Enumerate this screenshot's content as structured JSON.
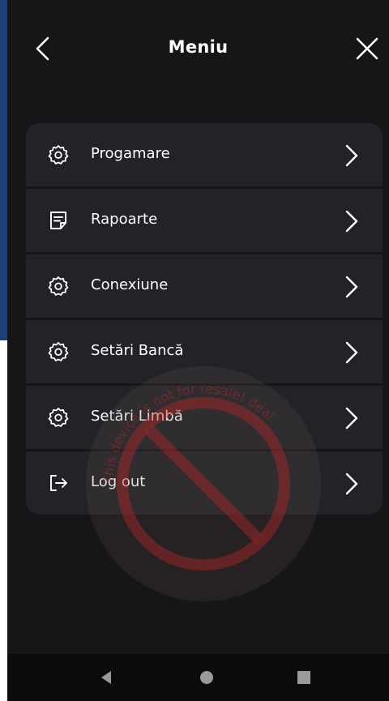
{
  "header": {
    "title": "Meniu",
    "back_icon": "chevron-left-icon",
    "close_icon": "close-icon"
  },
  "menu": {
    "items": [
      {
        "label": "Progamare",
        "icon": "gear-icon"
      },
      {
        "label": "Rapoarte",
        "icon": "document-icon"
      },
      {
        "label": "Conexiune",
        "icon": "gear-icon"
      },
      {
        "label": "Setări Bancă",
        "icon": "gear-icon"
      },
      {
        "label": "Setări Limbă",
        "icon": "gear-icon"
      },
      {
        "label": "Log out",
        "icon": "logout-icon"
      }
    ]
  },
  "watermark": {
    "text": "This device is not for resale! deal"
  },
  "nav": {
    "back": "nav-back-icon",
    "home": "nav-home-icon",
    "recents": "nav-recents-icon"
  },
  "colors": {
    "background": "#161618",
    "card": "#232327",
    "text": "#ffffff",
    "watermark": "#c0302f"
  }
}
